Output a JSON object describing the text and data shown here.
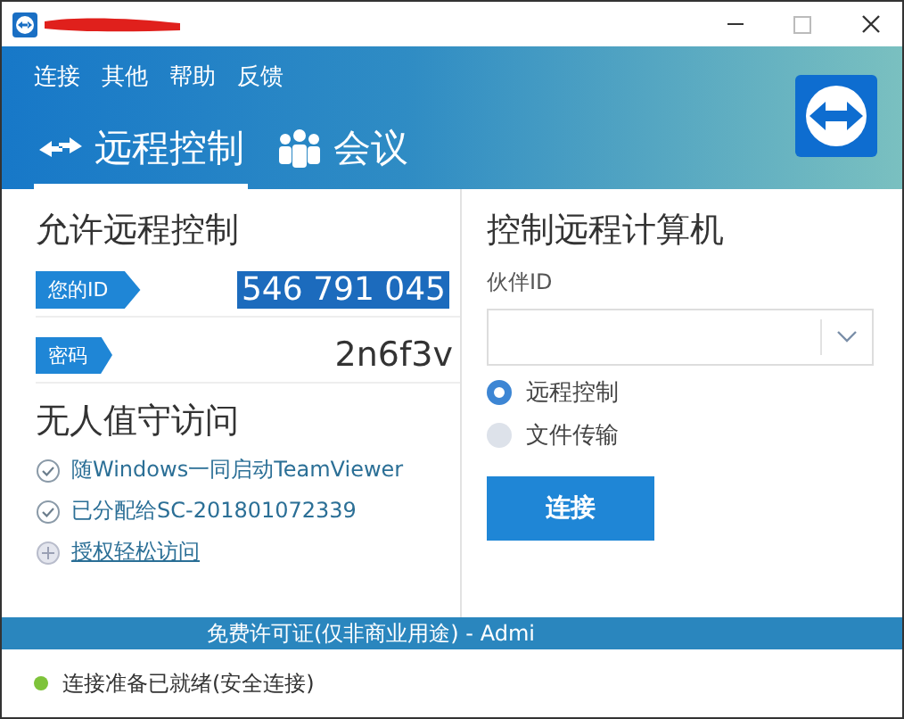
{
  "menu": [
    "连接",
    "其他",
    "帮助",
    "反馈"
  ],
  "tabs": [
    {
      "label": "远程控制",
      "kind": "control",
      "selected": true
    },
    {
      "label": "会议",
      "kind": "meeting",
      "selected": false
    }
  ],
  "allow": {
    "title": "允许远程控制",
    "id_label": "您的ID",
    "id_value": "546 791 045",
    "id_selected": true,
    "password_label": "密码",
    "password_value": "2n6f3v"
  },
  "unattended": {
    "title": "无人值守访问",
    "items": [
      {
        "label": "随Windows一同启动TeamViewer",
        "kind": "check"
      },
      {
        "label": "已分配给SC-201801072339",
        "kind": "check"
      },
      {
        "label": "授权轻松访问",
        "kind": "link"
      }
    ]
  },
  "control": {
    "title": "控制远程计算机",
    "partner_label": "伙伴ID",
    "modes": [
      {
        "label": "远程控制",
        "selected": true
      },
      {
        "label": "文件传输",
        "selected": false
      }
    ],
    "connect_button": "连接"
  },
  "license_bar": "免费许可证(仅非商业用途) - Admi",
  "status": {
    "text": "连接准备已就绪(安全连接)",
    "color": "#7ec33a"
  }
}
